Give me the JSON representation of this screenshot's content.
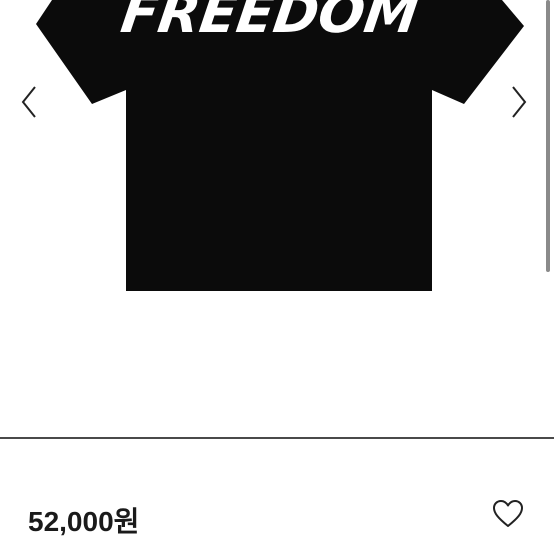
{
  "carousel": {
    "image_text": "FREEDOM",
    "prev_icon": "chevron-left-icon",
    "next_icon": "chevron-right-icon"
  },
  "product": {
    "price": "52,000원",
    "like_icon": "heart-icon"
  },
  "colors": {
    "shirt": "#0b0b0b",
    "divider": "#4a4a4a",
    "text": "#1a1a1a"
  }
}
